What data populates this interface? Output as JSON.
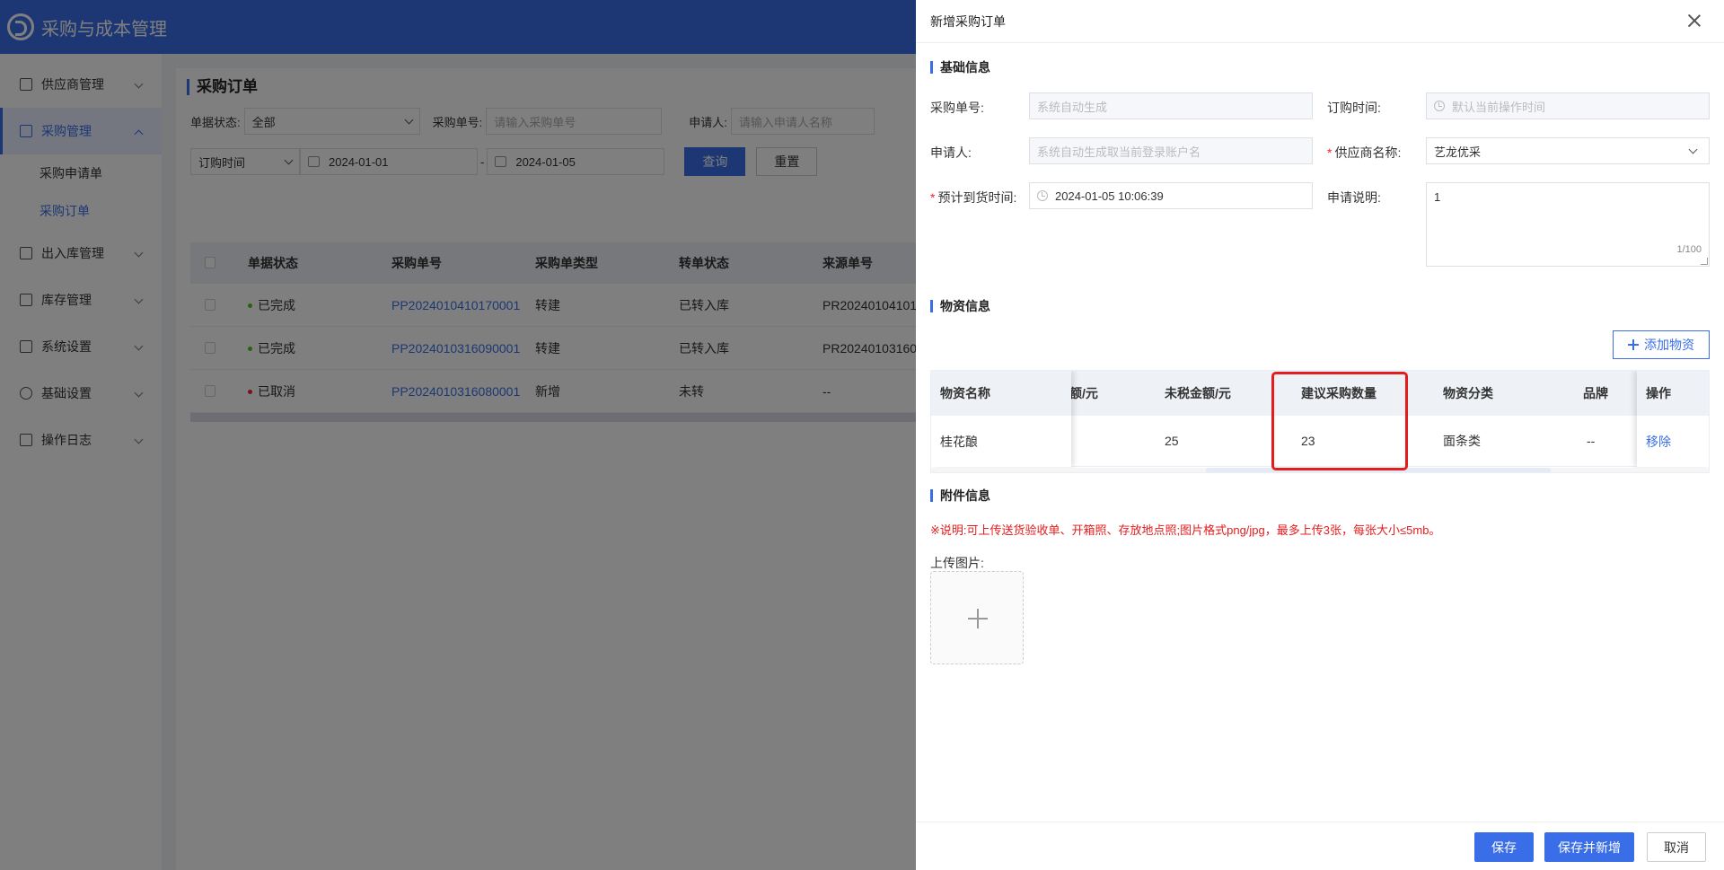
{
  "app": {
    "title": "采购与成本管理"
  },
  "sidebar": {
    "items": [
      {
        "label": "供应商管理"
      },
      {
        "label": "采购管理"
      },
      {
        "label": "出入库管理"
      },
      {
        "label": "库存管理"
      },
      {
        "label": "系统设置"
      },
      {
        "label": "基础设置"
      },
      {
        "label": "操作日志"
      }
    ],
    "submenu": [
      {
        "label": "采购申请单"
      },
      {
        "label": "采购订单"
      }
    ]
  },
  "page": {
    "title": "采购订单",
    "filters": {
      "status_label": "单据状态:",
      "status_value": "全部",
      "order_no_label": "采购单号:",
      "order_no_placeholder": "请输入采购单号",
      "applicant_label": "申请人:",
      "applicant_placeholder": "请输入申请人名称",
      "date_type": "订购时间",
      "date_start": "2024-01-01",
      "date_sep": "-",
      "date_end": "2024-01-05",
      "query_label": "查询",
      "reset_label": "重置"
    },
    "table": {
      "headers": [
        "单据状态",
        "采购单号",
        "采购单类型",
        "转单状态",
        "来源单号"
      ],
      "rows": [
        {
          "status": "已完成",
          "status_color": "#52c41a",
          "order_no": "PP2024010410170001",
          "type": "转建",
          "transfer": "已转入库",
          "source": "PR20240104101"
        },
        {
          "status": "已完成",
          "status_color": "#52c41a",
          "order_no": "PP2024010316090001",
          "type": "转建",
          "transfer": "已转入库",
          "source": "PR20240103160"
        },
        {
          "status": "已取消",
          "status_color": "#f5222d",
          "order_no": "PP2024010316080001",
          "type": "新增",
          "transfer": "未转",
          "source": "--"
        }
      ]
    }
  },
  "drawer": {
    "title": "新增采购订单",
    "basic": {
      "section_title": "基础信息",
      "order_no_label": "采购单号:",
      "order_no_placeholder": "系统自动生成",
      "order_time_label": "订购时间:",
      "order_time_placeholder": "默认当前操作时间",
      "applicant_label": "申请人:",
      "applicant_placeholder": "系统自动生成取当前登录账户名",
      "supplier_required": "*",
      "supplier_label": "供应商名称:",
      "supplier_value": "艺龙优采",
      "arrival_required": "*",
      "arrival_label": "预计到货时间:",
      "arrival_value": "2024-01-05 10:06:39",
      "remark_label": "申请说明:",
      "remark_value": "1",
      "remark_count": "1/100"
    },
    "materials": {
      "section_title": "物资信息",
      "add_label": "添加物资",
      "headers": [
        "物资名称",
        "额/元",
        "未税金额/元",
        "建议采购数量",
        "物资分类",
        "品牌",
        "操作"
      ],
      "row": {
        "name": "桂花酿",
        "untaxed": "25",
        "qty": "23",
        "category": "面条类",
        "brand": "--",
        "action": "移除"
      }
    },
    "attachments": {
      "section_title": "附件信息",
      "note": "※说明:可上传送货验收单、开箱照、存放地点照;图片格式png/jpg，最多上传3张，每张大小≤5mb。",
      "upload_label": "上传图片:"
    },
    "footer": {
      "save": "保存",
      "save_new": "保存并新增",
      "cancel": "取消"
    }
  },
  "colors": {
    "accent": "#3a6ee8",
    "success": "#52c41a",
    "danger": "#f5222d",
    "highlight": "#e41c1c"
  }
}
